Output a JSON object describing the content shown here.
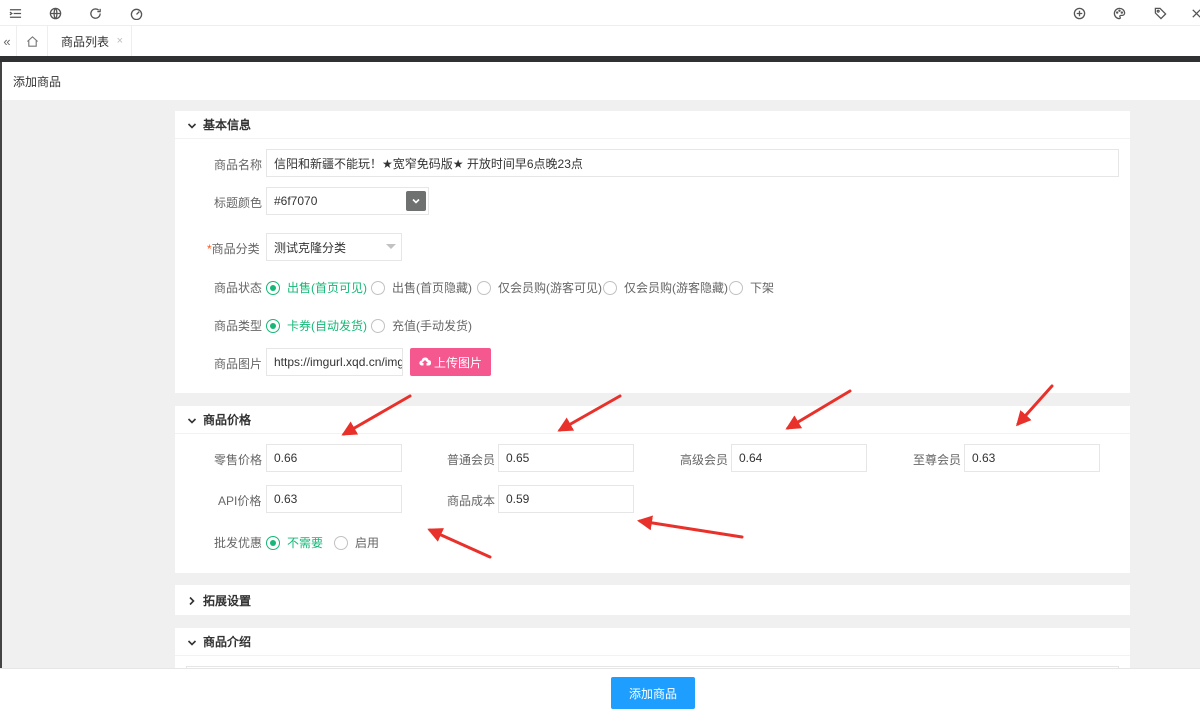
{
  "tabs": {
    "active_label": "商品列表",
    "close_glyph": "×"
  },
  "page": {
    "title": "添加商品"
  },
  "basic": {
    "header": "基本信息",
    "name_label": "商品名称",
    "name_value": "信阳和新疆不能玩！★宽窄免码版★ 开放时间早6点晚23点",
    "color_label": "标题颜色",
    "color_value": "#6f7070",
    "category_required": "*",
    "category_label": "商品分类",
    "category_value": "测试克隆分类",
    "status_label": "商品状态",
    "status_options": [
      "出售(首页可见)",
      "出售(首页隐藏)",
      "仅会员购(游客可见)",
      "仅会员购(游客隐藏)",
      "下架"
    ],
    "type_label": "商品类型",
    "type_options": [
      "卡券(自动发货)",
      "充值(手动发货)"
    ],
    "image_label": "商品图片",
    "image_value": "https://imgurl.xqd.cn/img_bm",
    "upload_label": "上传图片"
  },
  "price": {
    "header": "商品价格",
    "retail_label": "零售价格",
    "retail_value": "0.66",
    "normal_label": "普通会员",
    "normal_value": "0.65",
    "senior_label": "高级会员",
    "senior_value": "0.64",
    "supreme_label": "至尊会员",
    "supreme_value": "0.63",
    "api_label": "API价格",
    "api_value": "0.63",
    "cost_label": "商品成本",
    "cost_value": "0.59",
    "bulk_label": "批发优惠",
    "bulk_options": [
      "不需要",
      "启用"
    ]
  },
  "ext": {
    "header": "拓展设置"
  },
  "intro": {
    "header": "商品介绍"
  },
  "submit_label": "添加商品",
  "colors": {
    "accent_green": "#16b777",
    "upload_pink": "#f5588f",
    "submit_blue": "#1e9fff",
    "annotation_red": "#e8312a"
  }
}
